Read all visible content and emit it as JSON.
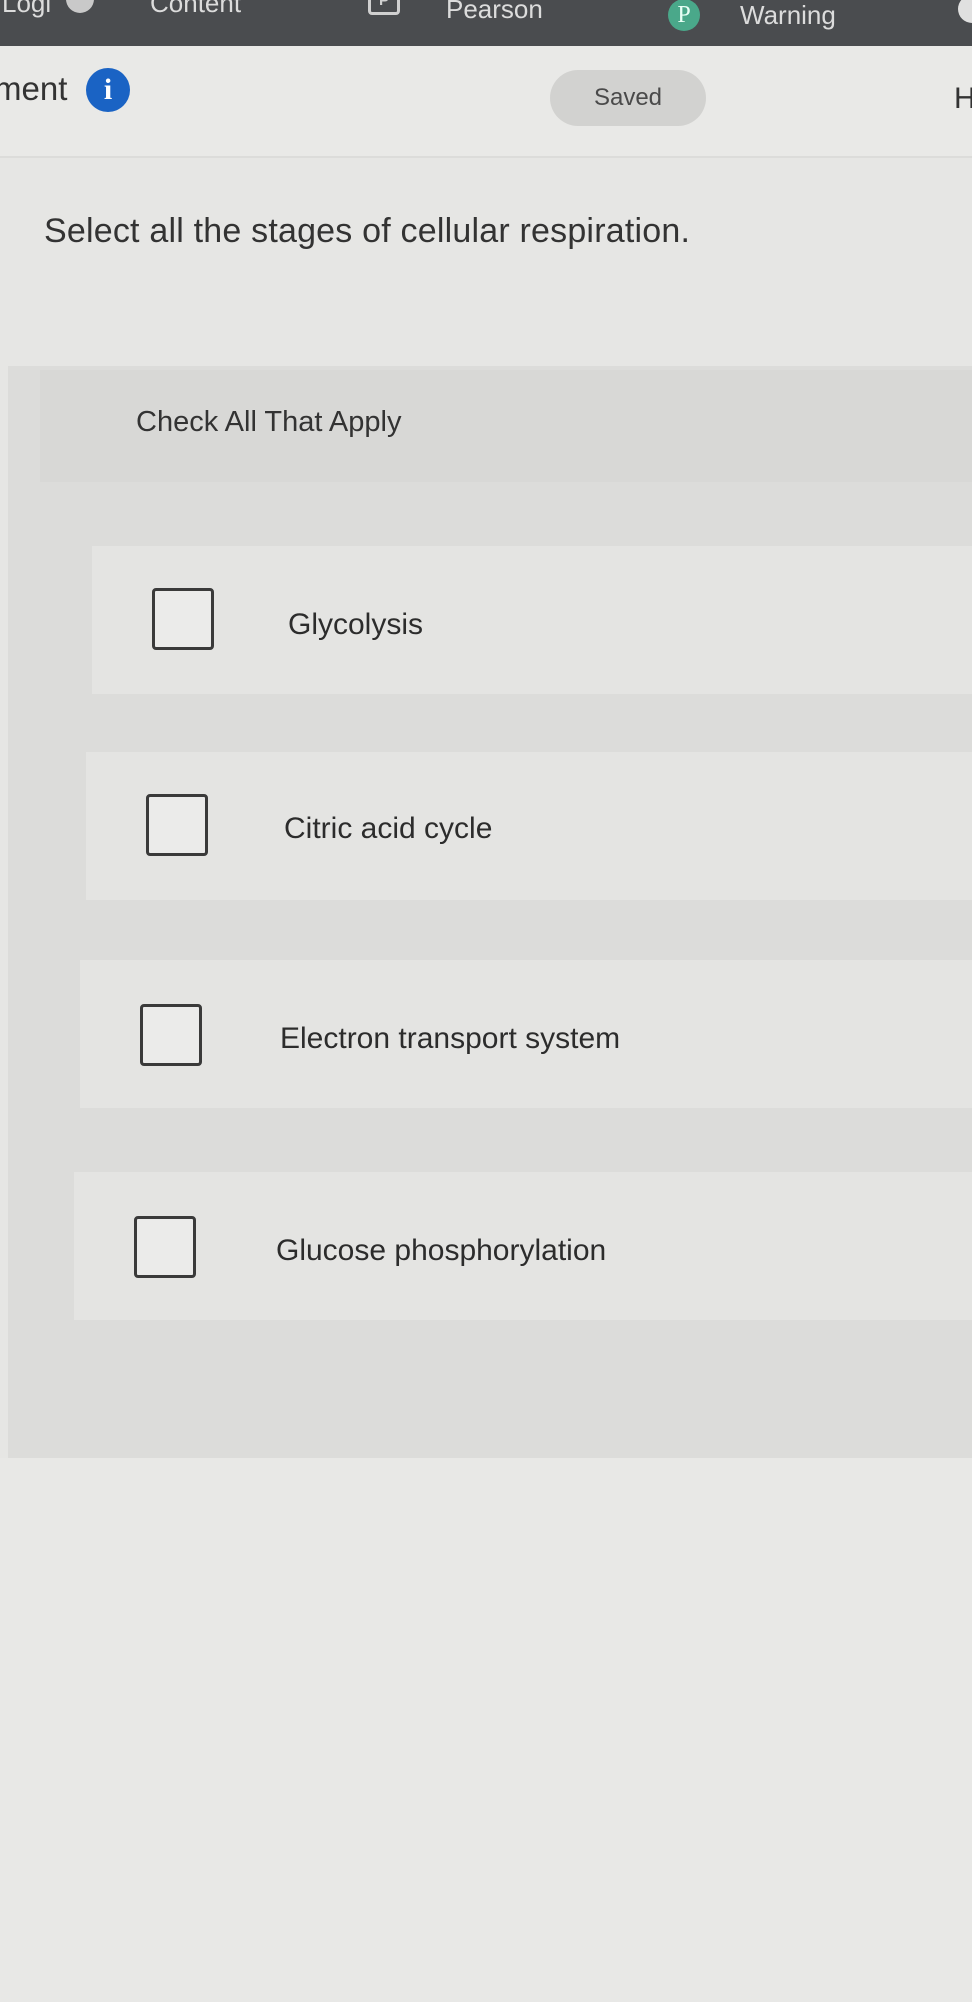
{
  "bookmarks": [
    {
      "label": "Logi",
      "icon": "round-app-icon"
    },
    {
      "label": "Content",
      "icon": "round-app-icon"
    },
    {
      "label": "Pearson",
      "icon": "p-square-icon"
    },
    {
      "label": "Warning",
      "icon": "pearson-p-circle-icon"
    }
  ],
  "header": {
    "title": "ment",
    "info_icon_glyph": "i",
    "saved_label": "Saved",
    "right_letter": "H"
  },
  "question": {
    "prompt": "Select all the stages of cellular respiration.",
    "instruction": "Check All That Apply",
    "options": [
      {
        "label": "Glycolysis",
        "checked": false
      },
      {
        "label": "Citric acid cycle",
        "checked": false
      },
      {
        "label": "Electron transport system",
        "checked": false
      },
      {
        "label": "Glucose phosphorylation",
        "checked": false
      }
    ]
  },
  "colors": {
    "info_icon": "#1a63c4",
    "toolbar": "#4a4c4f",
    "pearson_icon": "#4aa88a"
  }
}
